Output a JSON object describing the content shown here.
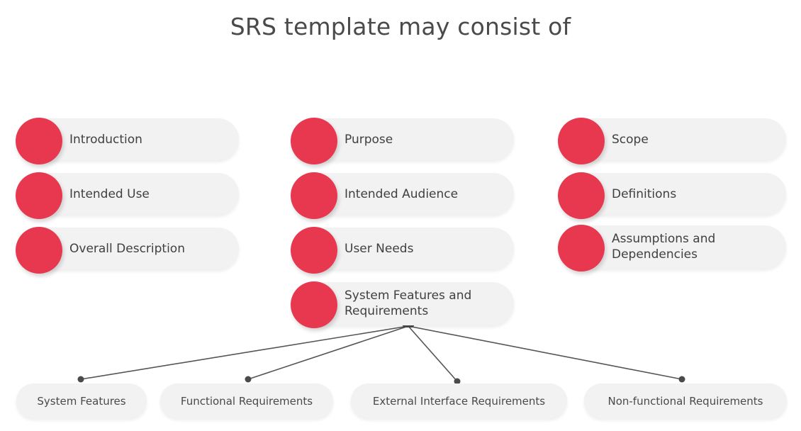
{
  "diagram": {
    "title": "SRS template may consist of",
    "colors": {
      "bullet": "#e8384f",
      "pill_background": "#f2f2f2",
      "text": "#404040",
      "title_text": "#4a4a4a",
      "connector": "#555555",
      "page_background": "#ffffff"
    },
    "columns": [
      {
        "name": "column-1",
        "items": [
          {
            "label": "Introduction"
          },
          {
            "label": "Intended Use"
          },
          {
            "label": "Overall Description"
          }
        ]
      },
      {
        "name": "column-2",
        "items": [
          {
            "label": "Purpose"
          },
          {
            "label": "Intended Audience"
          },
          {
            "label": "User Needs"
          },
          {
            "label": "System Features and\nRequirements"
          }
        ]
      },
      {
        "name": "column-3",
        "items": [
          {
            "label": "Scope"
          },
          {
            "label": "Definitions"
          },
          {
            "label": "Assumptions and\nDependencies"
          }
        ]
      }
    ],
    "children": {
      "parent": "System Features and Requirements",
      "items": [
        {
          "label": "System Features"
        },
        {
          "label": "Functional Requirements"
        },
        {
          "label": "External Interface Requirements"
        },
        {
          "label": "Non-functional Requirements"
        }
      ]
    }
  }
}
